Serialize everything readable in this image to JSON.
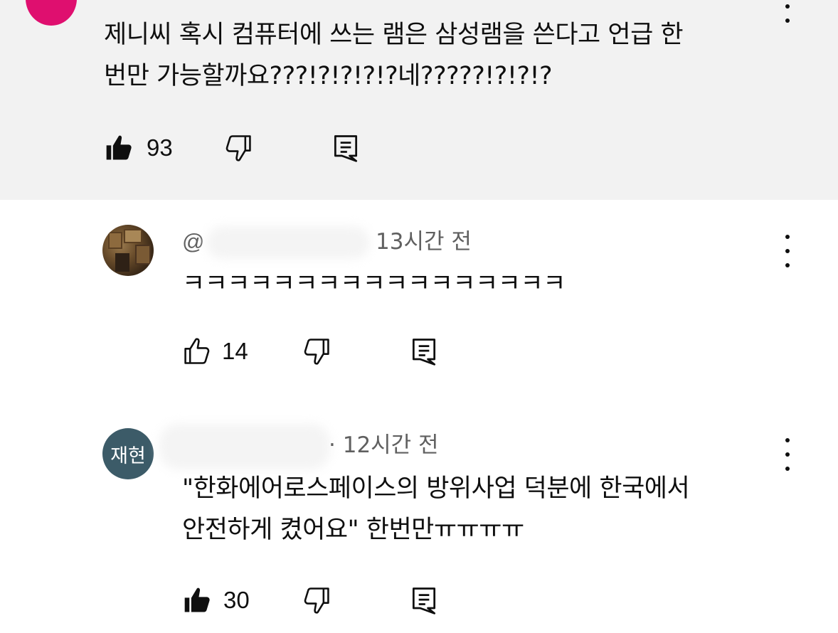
{
  "comments": [
    {
      "text": "제니씨 혹시 컴퓨터에 쓰는 램은 삼성램을 쓴다고 언급 한\n번만 가능할까요???!?!?!?!?네?????!?!?!?",
      "likes": "93",
      "liked": true,
      "highlighted": true,
      "avatar_color": "#df0f6f"
    },
    {
      "handle": "@",
      "time": "13시간 전",
      "text": "ㅋㅋㅋㅋㅋㅋㅋㅋㅋㅋㅋㅋㅋㅋㅋㅋㅋ",
      "likes": "14",
      "liked": false
    },
    {
      "avatar_initials": "재현",
      "avatar_color": "#3c5b68",
      "time": "12시간 전",
      "text": "\"한화에어로스페이스의 방위사업 덕분에 한국에서\n안전하게 켰어요\" 한번만ㅠㅠㅠㅠ",
      "likes": "30",
      "liked": true
    }
  ],
  "icons": [
    "like-icon",
    "dislike-icon",
    "reply-icon",
    "more-icon"
  ],
  "colors": {
    "highlight_bg": "#f2f2f2",
    "meta_text": "#606060",
    "text": "#0f0f0f"
  }
}
